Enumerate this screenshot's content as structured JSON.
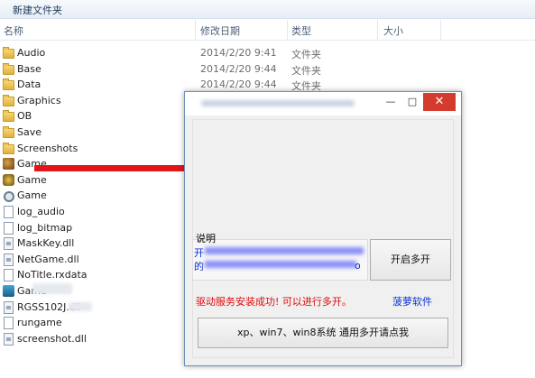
{
  "toolbar": {
    "new_folder_label": "新建文件夹"
  },
  "columns": {
    "name": "名称",
    "date": "修改日期",
    "type": "类型",
    "size": "大小"
  },
  "files": [
    {
      "name": "Audio",
      "date": "2014/2/20 9:41",
      "type": "文件夹",
      "icon": "folder-icon"
    },
    {
      "name": "Base",
      "date": "2014/2/20 9:44",
      "type": "文件夹",
      "icon": "folder-icon"
    },
    {
      "name": "Data",
      "date": "2014/2/20 9:44",
      "type": "文件夹",
      "icon": "folder-icon"
    },
    {
      "name": "Graphics",
      "date": "",
      "type": "",
      "icon": "folder-icon"
    },
    {
      "name": "OB",
      "date": "",
      "type": "",
      "icon": "folder-icon"
    },
    {
      "name": "Save",
      "date": "",
      "type": "",
      "icon": "folder-icon"
    },
    {
      "name": "Screenshots",
      "date": "",
      "type": "",
      "icon": "folder-icon"
    },
    {
      "name": "Game",
      "date": "",
      "type": "",
      "icon": "game-icon"
    },
    {
      "name": "Game",
      "date": "",
      "type": "",
      "icon": "game-icon"
    },
    {
      "name": "Game",
      "date": "",
      "type": "",
      "icon": "settings-file-icon"
    },
    {
      "name": "log_audio",
      "date": "",
      "type": "",
      "icon": "text-file-icon"
    },
    {
      "name": "log_bitmap",
      "date": "",
      "type": "",
      "icon": "text-file-icon"
    },
    {
      "name": "MaskKey.dll",
      "date": "",
      "type": "",
      "icon": "dll-file-icon"
    },
    {
      "name": "NetGame.dll",
      "date": "",
      "type": "",
      "icon": "dll-file-icon"
    },
    {
      "name": "NoTitle.rxdata",
      "date": "",
      "type": "",
      "icon": "text-file-icon"
    },
    {
      "name": "Game",
      "date": "",
      "type": "",
      "icon": "app-icon"
    },
    {
      "name": "RGSS102J.dll",
      "date": "",
      "type": "",
      "icon": "dll-file-icon"
    },
    {
      "name": "rungame",
      "date": "",
      "type": "",
      "icon": "text-file-icon"
    },
    {
      "name": "screenshot.dll",
      "date": "",
      "type": "",
      "icon": "dll-file-icon"
    }
  ],
  "dialog": {
    "minimize": "—",
    "maximize": "□",
    "close": "✕",
    "info_label": "说明",
    "info_line1": "开",
    "info_line2": "的",
    "info_line2_tail": "o",
    "start_button": "开启多开",
    "success_text": "驱动服务安装成功! 可以进行多开。",
    "brand_link": "菠萝软件",
    "xp_button": "xp、win7、win8系统 通用多开请点我"
  },
  "colors": {
    "arrow": "#e0161b",
    "success": "#e00a0a",
    "link": "#0b2fd6",
    "close": "#d53a2e"
  }
}
